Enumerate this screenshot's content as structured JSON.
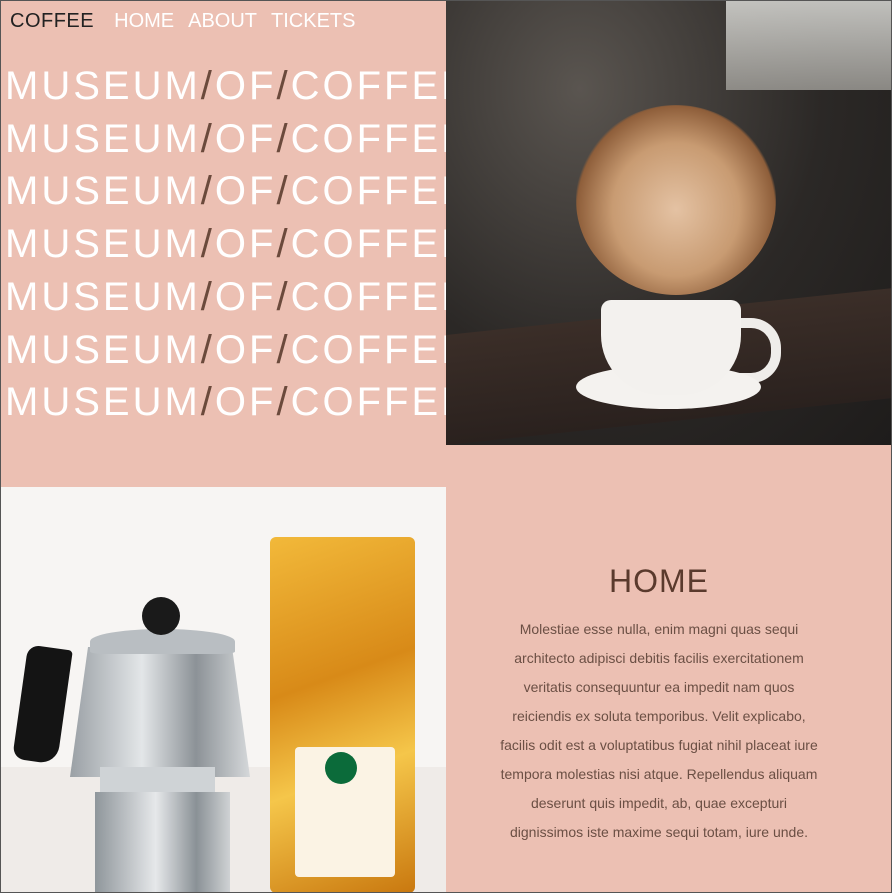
{
  "nav": {
    "brand": "COFFEE",
    "links": [
      "HOME",
      "ABOUT",
      "TICKETS"
    ]
  },
  "hero": {
    "word1": "MUSEUM",
    "word2": "OF",
    "word3": "COFFEE",
    "slash": "/"
  },
  "section": {
    "title": "HOME",
    "body": "Molestiae esse nulla, enim magni quas sequi architecto adipisci debitis facilis exercitationem veritatis consequuntur ea impedit nam quos reiciendis ex soluta temporibus. Velit explicabo, facilis odit est a voluptatibus fugiat nihil placeat iure tempora molestias nisi atque. Repellendus aliquam deserunt quis impedit, ab, quae excepturi dignissimos iste maxime sequi totam, iure unde."
  },
  "colors": {
    "panel": "#ecc0b3",
    "accent_text": "#5a3a2d",
    "slash": "#6b4a3c"
  }
}
